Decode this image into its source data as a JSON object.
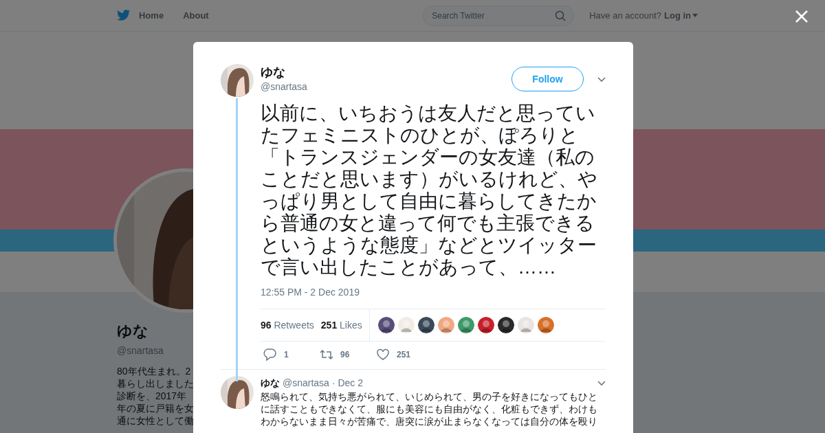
{
  "top_bar": {
    "nav": [
      {
        "label": "Home"
      },
      {
        "label": "About"
      }
    ],
    "search": {
      "placeholder": "Search Twitter"
    },
    "account_prompt": "Have an account?",
    "login": "Log in"
  },
  "profile": {
    "name": "ゆな",
    "handle": "@snartasa",
    "bio_lines": [
      "80年代生まれ。2",
      "暮らし出しました",
      "診断を、2017年",
      "年の夏に戸籍を女",
      "通に女性として働"
    ]
  },
  "tweet": {
    "author": "ゆな",
    "handle": "@snartasa",
    "follow_button": "Follow",
    "text": "以前に、いちおうは友人だと思っていたフェミニストのひとが、ぽろりと「トランスジェンダーの女友達（私のことだと思います）がいるけれど、やっぱり男として自由に暮らしてきたから普通の女と違って何でも主張できるというような態度」などとツイッターで言い出したことがあって、……",
    "timestamp": "12:55 PM - 2 Dec 2019",
    "retweets_count": "96",
    "retweets_label": "Retweets",
    "likes_count": "251",
    "likes_label": "Likes",
    "likers": [
      {
        "color": "#5a4e7a"
      },
      {
        "color": "#f2ece6"
      },
      {
        "color": "#3b4a5a"
      },
      {
        "color": "#f0a882"
      },
      {
        "color": "#3f9a6a"
      },
      {
        "color": "#c8202a"
      },
      {
        "color": "#2a2a2a"
      },
      {
        "color": "#e8e4e2"
      },
      {
        "color": "#d8702a"
      }
    ],
    "actions": [
      {
        "kind": "reply",
        "count": "1"
      },
      {
        "kind": "retweet",
        "count": "96"
      },
      {
        "kind": "like",
        "count": "251"
      }
    ]
  },
  "reply": {
    "author": "ゆな",
    "handle": "@snartasa",
    "date": "· Dec 2",
    "lines": [
      "怒鳴られて、気持ち悪がられて、いじめられて、男の子を好きになってもひと",
      "に話すこともできなくて、服にも美容にも自由がなく、化粧もできず、わけも",
      "わからないまま日々が苦痛で、唐突に涙が止まらなくなっては自分の体を殴り"
    ]
  }
}
